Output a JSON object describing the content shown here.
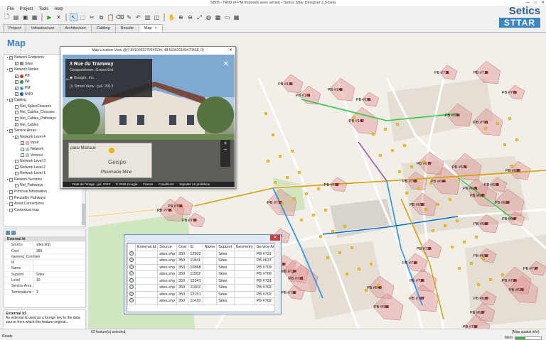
{
  "window": {
    "title": "SB05 - NRO et PM imposés avec aérien - Setics Sttar Designer 2.0-beta",
    "controls": [
      "—",
      "□",
      "✕"
    ]
  },
  "menu": [
    "File",
    "Project",
    "Tools",
    "Help"
  ],
  "logo": {
    "line1": "Setics",
    "line2": "STTAR"
  },
  "tabs": [
    "Project",
    "Infrastructure",
    "Architecture",
    "Cabling",
    "Results",
    "Map"
  ],
  "active_tab": "Map",
  "map_title": "Map",
  "layers": [
    {
      "label": "Network Endpoints",
      "level": 0,
      "checked": true,
      "arrow": "▾"
    },
    {
      "label": "Sites",
      "level": 1,
      "checked": true,
      "color": "#888888"
    },
    {
      "label": "Network Nodes",
      "level": 0,
      "checked": true,
      "arrow": "▾"
    },
    {
      "label": "PB",
      "level": 1,
      "checked": true,
      "color": "#d93030"
    },
    {
      "label": "PA",
      "level": 1,
      "checked": true,
      "color": "#2e8b3a"
    },
    {
      "label": "PM",
      "level": 1,
      "checked": true,
      "color": "#4aa0d8"
    },
    {
      "label": "NRO",
      "level": 1,
      "checked": true,
      "color": "#2a58a8"
    },
    {
      "label": "Cabling",
      "level": 0,
      "checked": true,
      "arrow": "▾"
    },
    {
      "label": "Net_SpliceClosures",
      "level": 1,
      "checked": false
    },
    {
      "label": "Net_Cables_Closures",
      "level": 1,
      "checked": false
    },
    {
      "label": "Net_Cables_Pathways",
      "level": 1,
      "checked": false
    },
    {
      "label": "Net_Cables",
      "level": 1,
      "checked": true
    },
    {
      "label": "Service Areas",
      "level": 0,
      "checked": true,
      "arrow": "▾"
    },
    {
      "label": "Network Level 4",
      "level": 1,
      "checked": true,
      "arrow": "▾"
    },
    {
      "label": "Input",
      "level": 2,
      "checked": true,
      "color": "#e8b0b0"
    },
    {
      "label": "Network",
      "level": 2,
      "checked": false,
      "color": "#a8d8a8"
    },
    {
      "label": "Voronoi",
      "level": 2,
      "checked": false,
      "color": "#c0c0e8"
    },
    {
      "label": "Network Level 3",
      "level": 1,
      "checked": false,
      "arrow": "›"
    },
    {
      "label": "Network Level 2",
      "level": 1,
      "checked": false,
      "arrow": "›"
    },
    {
      "label": "Network Level 1",
      "level": 1,
      "checked": false,
      "arrow": "›"
    },
    {
      "label": "Network Sections",
      "level": 0,
      "checked": false,
      "arrow": "▾"
    },
    {
      "label": "Net_Pathways",
      "level": 1,
      "checked": false
    },
    {
      "label": "Punctual Information",
      "level": 0,
      "checked": false,
      "arrow": "›"
    },
    {
      "label": "Reusable Pathways",
      "level": 0,
      "checked": false,
      "arrow": "›"
    },
    {
      "label": "Asset Connections",
      "level": 0,
      "checked": false,
      "arrow": "›"
    },
    {
      "label": "Contextual map",
      "level": 0,
      "checked": false,
      "arrow": "›"
    }
  ],
  "properties": {
    "header": "External Id",
    "rows": [
      {
        "k": "Source",
        "v": "sites.shp"
      },
      {
        "k": "Cost",
        "v": "350"
      },
      {
        "k": "General_CostGen",
        "v": ""
      },
      {
        "k": "Id",
        "v": ""
      },
      {
        "k": "Name",
        "v": ""
      },
      {
        "k": "Support",
        "v": "Sites"
      },
      {
        "k": "Level",
        "v": "10"
      },
      {
        "k": "Service Area",
        "v": ""
      },
      {
        "k": "Terminations",
        "v": "1"
      }
    ],
    "desc_title": "External Id",
    "desc_text": "An external id used as a foreign key to the data source from which this feature originat..."
  },
  "streetview": {
    "title": "Map Location View @(7.84103532796411​94, 48.5156201894704​68, 0)",
    "address": "3 Rue du Tramway",
    "city": "Geispolsheim, Grand Est",
    "provider": "Google, Inc.",
    "date": "Street View - juil. 2013",
    "minimap_labels": [
      "pace Malraux",
      "Geispo",
      "Pharmacie Mine"
    ],
    "footer": [
      "Date de l'image : juil. 2013",
      "© 2018 Google",
      "France",
      "Conditions",
      "Signaler un problème"
    ]
  },
  "table": {
    "columns": [
      "",
      "External Id",
      "Source",
      "Cost",
      "Id",
      "Name",
      "Support",
      "Geometry",
      "Service Are"
    ],
    "rows": [
      [
        "sites.shp",
        "350",
        "12502",
        "Sites",
        "PB #731"
      ],
      [
        "sites.shp",
        "350",
        "11841",
        "Sites",
        "PB #637"
      ],
      [
        "sites.shp",
        "350",
        "10868",
        "Sites",
        "PB #709"
      ],
      [
        "sites.shp",
        "350",
        "11502",
        "Sites",
        "PB #709"
      ],
      [
        "sites.shp",
        "350",
        "12041",
        "Sites",
        "PB #731"
      ],
      [
        "sites.shp",
        "350",
        "11902",
        "Sites",
        "PB #702"
      ],
      [
        "sites.shp",
        "350",
        "12151",
        "Sites",
        "PB #702"
      ],
      [
        "sites.shp",
        "350",
        "11419",
        "Sites",
        "PB #702"
      ]
    ]
  },
  "map_labels": [
    "PB #715",
    "PB #135",
    "PB #148",
    "PB #162",
    "PB #151",
    "PB #161",
    "PB #696",
    "PB #701",
    "PB #779",
    "PB #706",
    "PB #705",
    "PB #713",
    "PB #704",
    "PB #681",
    "PB #682",
    "PB #689",
    "PB #687",
    "PB #688",
    "PB #693",
    "PB #694",
    "PB #692",
    "PB #720",
    "PB #724",
    "PB #721",
    "PB #722",
    "PB #725",
    "PB #640",
    "PB #658",
    "PB #639",
    "PB #637",
    "PB #732",
    "PB #729",
    "PB #727",
    "PB #719",
    "PB #726",
    "PB #707",
    "PB #708",
    "PB #703",
    "PB #677",
    "PB #676",
    "PB #678",
    "PB #680",
    "PB #715",
    "PB #673",
    "PB #782"
  ],
  "status": {
    "left": "Ready",
    "center": "62 feature(s) selected.",
    "right": "[Map spatial info]",
    "mem": "Mem"
  }
}
